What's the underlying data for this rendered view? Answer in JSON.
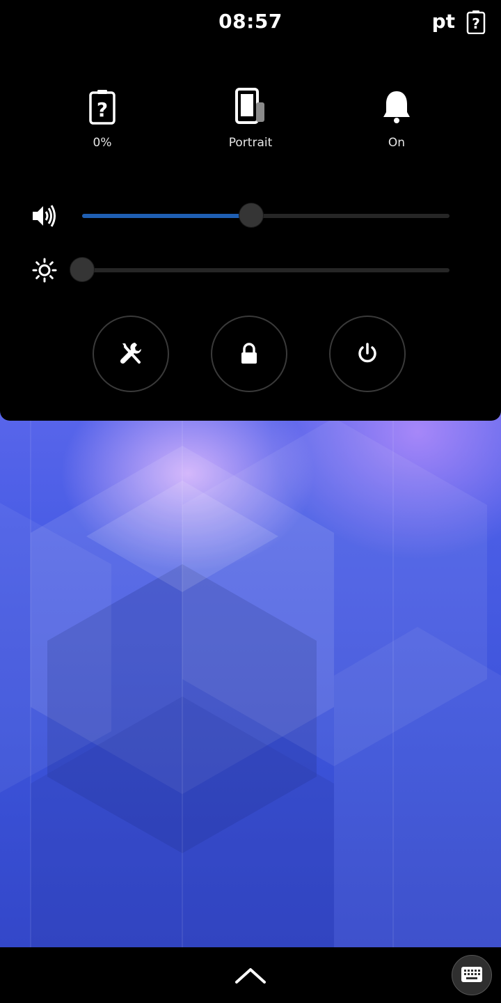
{
  "status_bar": {
    "time": "08:57",
    "keyboard_layout": "pt",
    "battery_icon": "battery-missing-icon"
  },
  "quick_toggles": [
    {
      "icon": "battery-missing-icon",
      "label": "0%"
    },
    {
      "icon": "rotation-portrait-icon",
      "label": "Portrait"
    },
    {
      "icon": "bell-icon",
      "label": "On"
    }
  ],
  "sliders": {
    "volume": {
      "icon": "speaker-volume-icon",
      "level": 0.46
    },
    "brightness": {
      "icon": "brightness-icon",
      "level": 0.0
    }
  },
  "action_buttons": [
    {
      "icon": "settings-tools-icon"
    },
    {
      "icon": "lock-icon"
    },
    {
      "icon": "power-icon"
    }
  ],
  "bottom_bar": {
    "home_icon": "chevron-up-icon",
    "osk_icon": "keyboard-icon"
  },
  "colors": {
    "panel_bg": "#000000",
    "accent": "#1f5fb3",
    "wallpaper_top": "#8f7ff0",
    "wallpaper_bottom": "#3347c9"
  }
}
